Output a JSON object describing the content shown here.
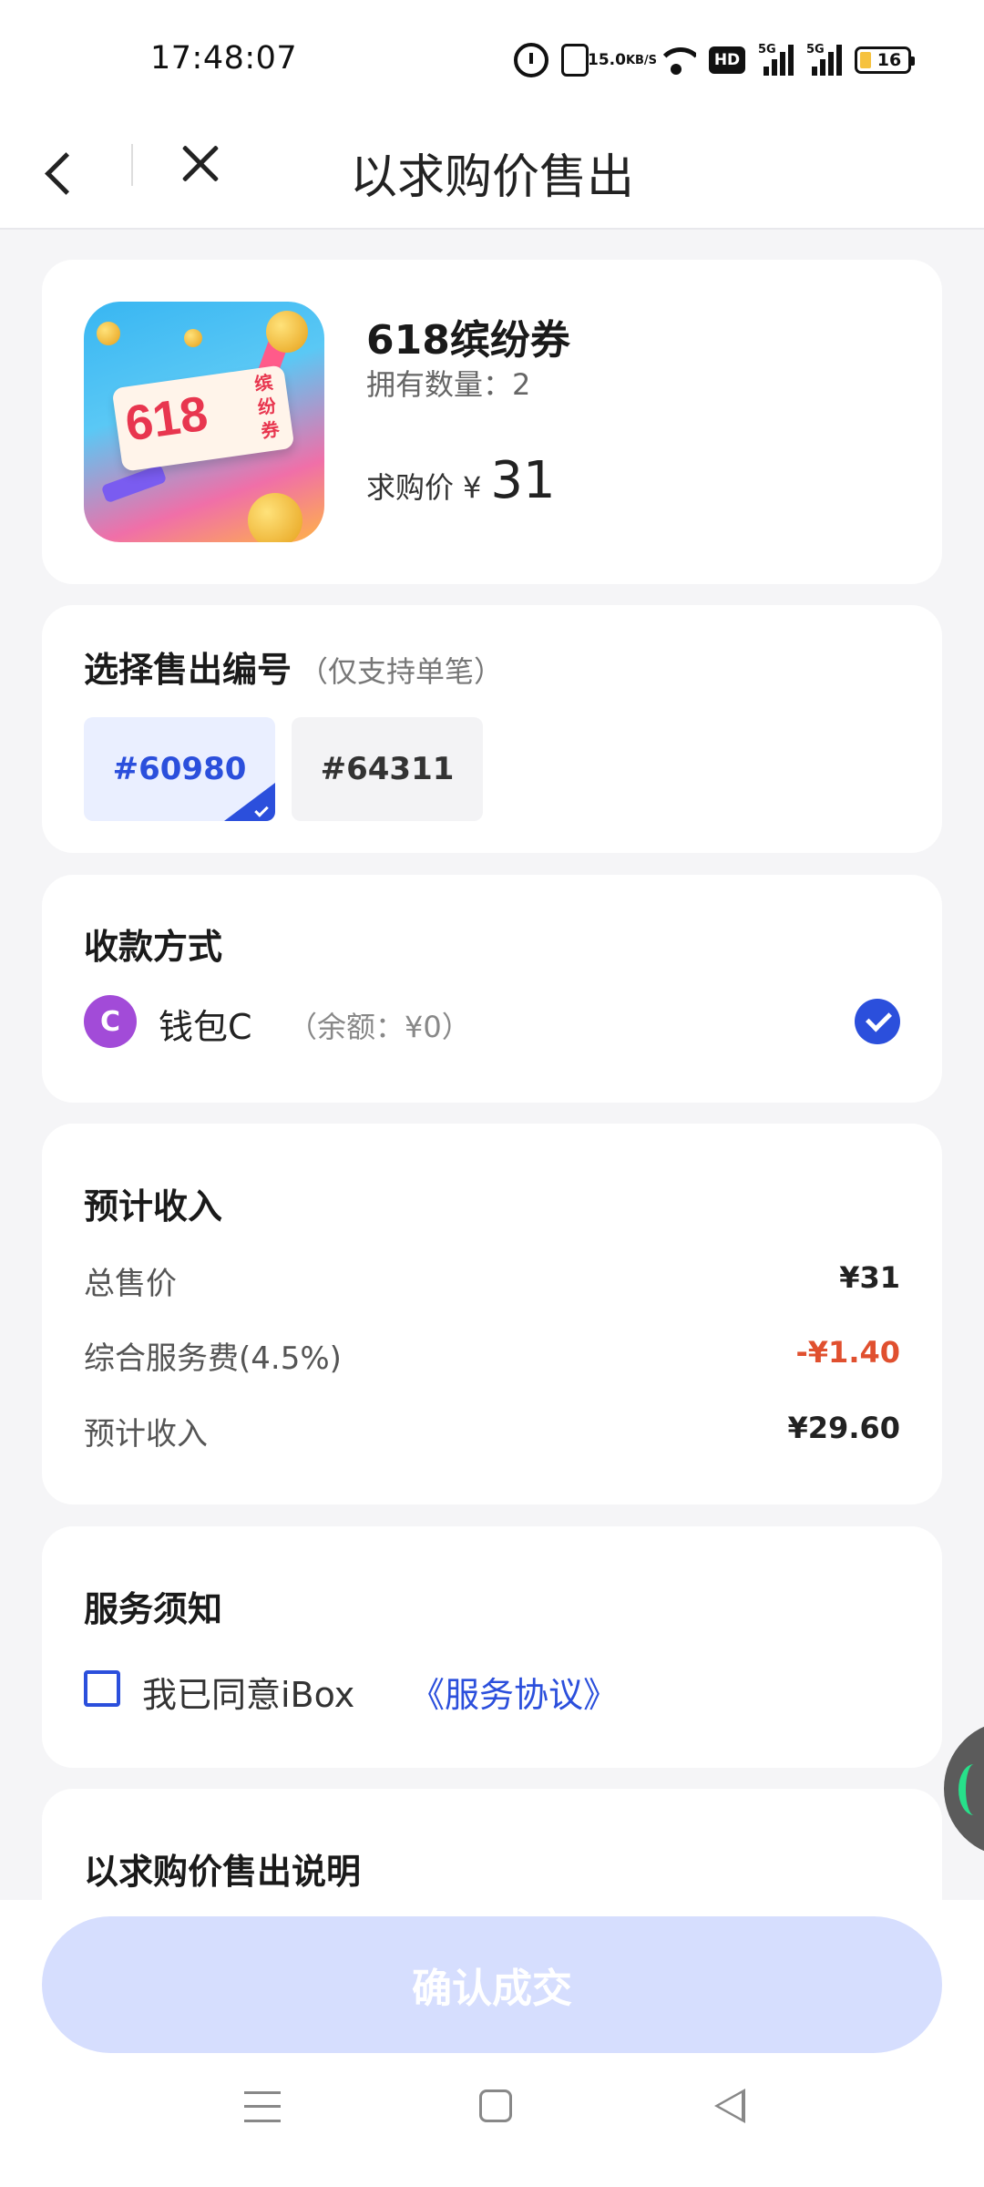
{
  "status_bar": {
    "time": "17:48:07",
    "net_speed_value": "15.0",
    "net_speed_unit": "KB/S",
    "hd_label": "HD",
    "signal1_label": "5G",
    "signal2_label": "5G",
    "battery": "16",
    "icons": [
      "alarm-icon",
      "vibrate-icon",
      "wifi-icon",
      "hd-icon",
      "signal-icon",
      "signal-icon",
      "battery-icon"
    ]
  },
  "header": {
    "title": "以求购价售出",
    "icons": [
      "back-icon",
      "close-icon"
    ]
  },
  "product": {
    "name": "618缤纷券",
    "owned_label": "拥有数量：2",
    "ask_label": "求购价",
    "currency": "¥",
    "ask_amount": "31",
    "image_text_main": "618",
    "image_text_side": "缤纷券"
  },
  "serial_section": {
    "title": "选择售出编号",
    "note": "（仅支持单笔）",
    "options": [
      {
        "label": "#60980",
        "selected": true
      },
      {
        "label": "#64311",
        "selected": false
      }
    ]
  },
  "payment": {
    "title": "收款方式",
    "wallet_icon_letter": "C",
    "wallet_name": "钱包C",
    "balance": "（余额：¥0）",
    "selected": true
  },
  "income": {
    "title": "预计收入",
    "rows": [
      {
        "label": "总售价",
        "value": "¥31"
      },
      {
        "label": "综合服务费(4.5%)",
        "value": "-¥1.40"
      },
      {
        "label": "预计收入",
        "value": "¥29.60"
      }
    ]
  },
  "notice": {
    "title": "服务须知",
    "agree_text": "我已同意iBox",
    "agree_link": "《服务协议》",
    "checked": false
  },
  "explain": {
    "title": "以求购价售出说明"
  },
  "footer": {
    "confirm_label": "确认成交"
  },
  "colors": {
    "accent": "#2b4fdc",
    "negative": "#e0502f",
    "confirm_disabled": "#d6defe",
    "wallet": "#a24bd8"
  }
}
